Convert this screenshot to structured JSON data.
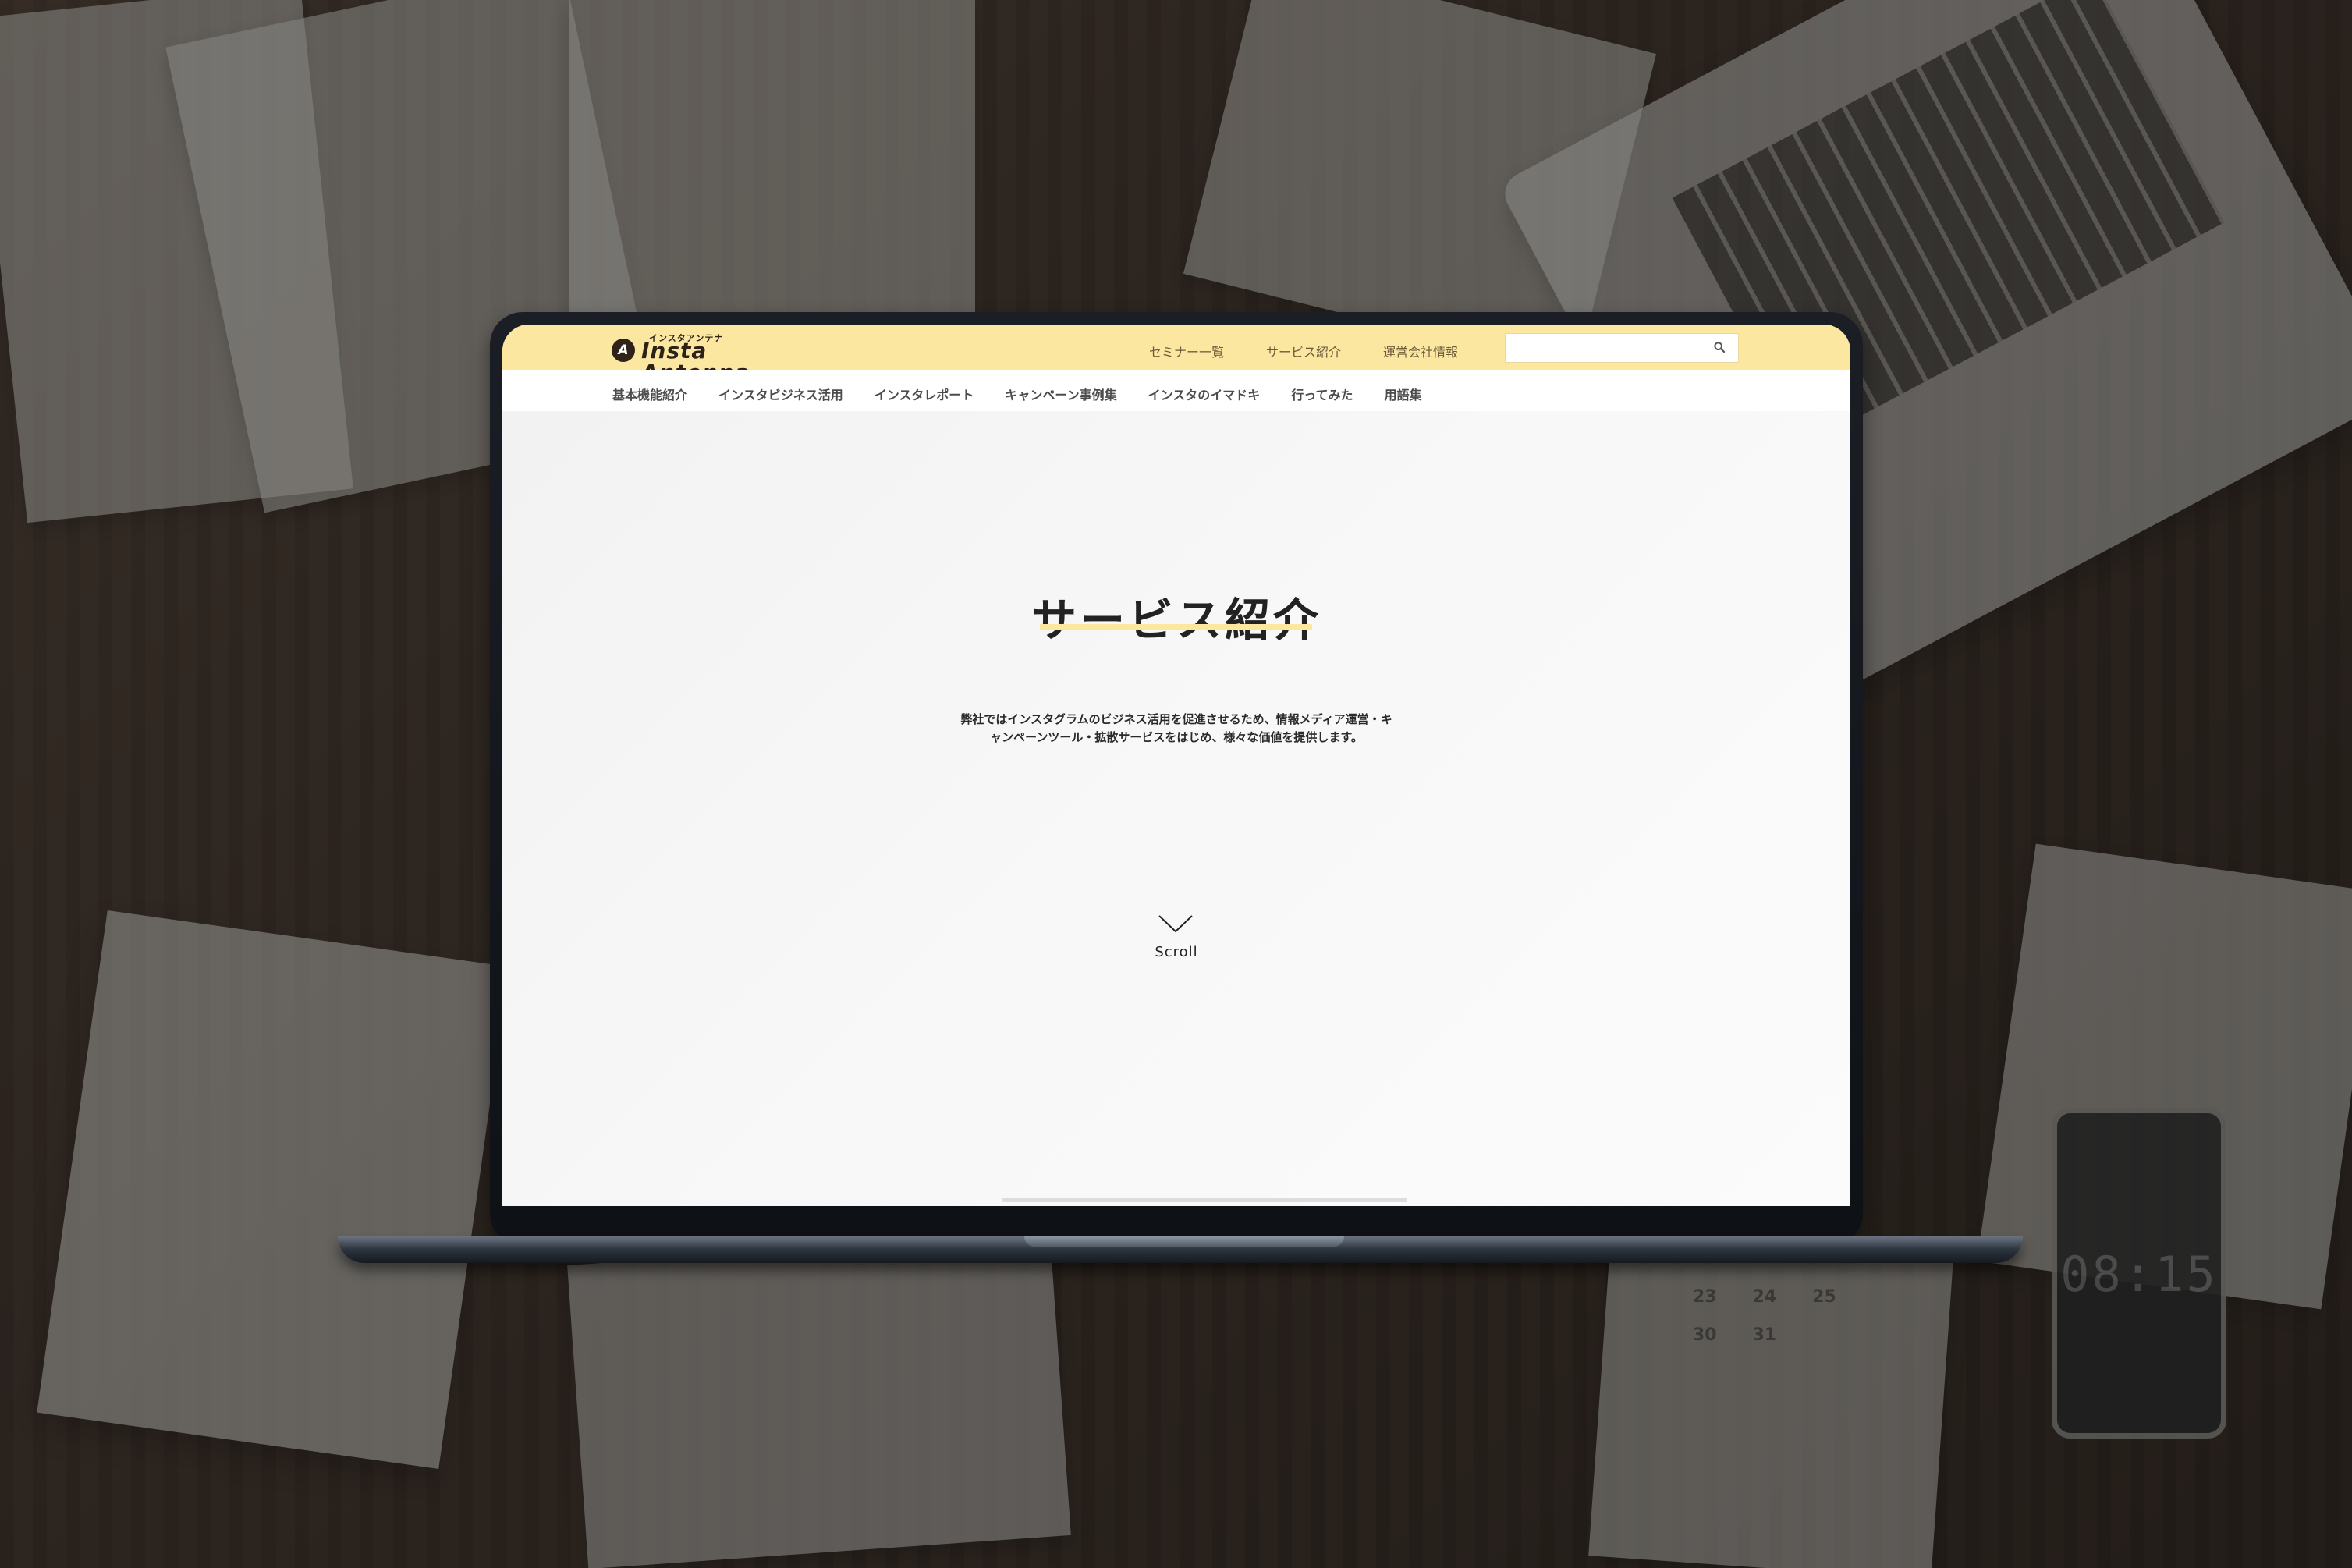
{
  "header": {
    "logo_kana": "インスタアンテナ",
    "logo_text": "Insta Antenna",
    "top_nav": [
      {
        "label": "セミナー一覧"
      },
      {
        "label": "サービス紹介"
      },
      {
        "label": "運営会社情報"
      }
    ],
    "search": {
      "placeholder": "",
      "icon": "search-icon"
    }
  },
  "sub_nav": [
    {
      "label": "基本機能紹介"
    },
    {
      "label": "インスタビジネス活用"
    },
    {
      "label": "インスタレポート"
    },
    {
      "label": "キャンペーン事例集"
    },
    {
      "label": "インスタのイマドキ"
    },
    {
      "label": "行ってみた"
    },
    {
      "label": "用語集"
    }
  ],
  "main": {
    "title": "サービス紹介",
    "intro_line_1": "弊社ではインスタグラムのビジネス活用を促進させるため、情報メディア運営・キ",
    "intro_line_2": "ャンペーンツール・拡散サービスをはじめ、様々な価値を提供します。",
    "scroll_label": "Scroll"
  },
  "background": {
    "phone_time": "08:15",
    "calendar": [
      [
        "23",
        "24",
        "25"
      ],
      [
        "30",
        "31",
        ""
      ]
    ]
  },
  "colors": {
    "header_bg": "#fbe7a0",
    "accent": "#fbe7a0",
    "text": "#222222",
    "nav_text": "#6c5b3b"
  }
}
